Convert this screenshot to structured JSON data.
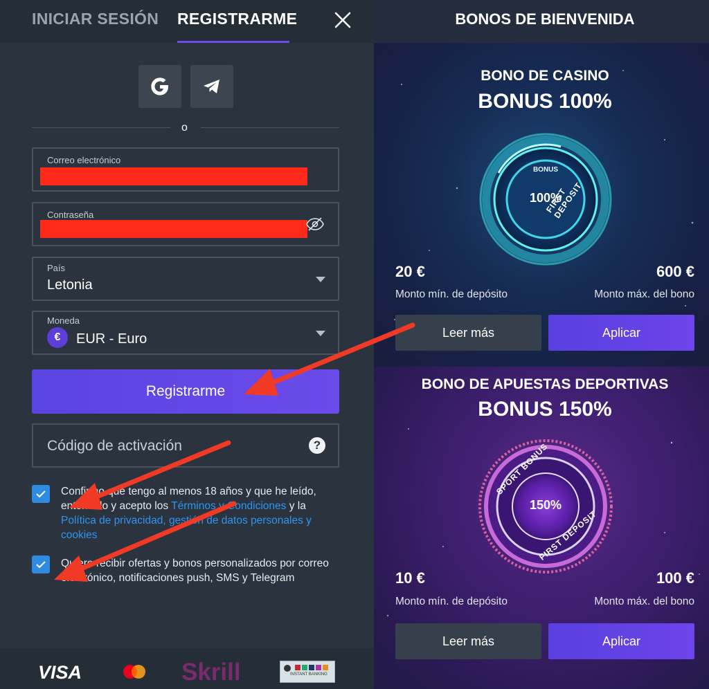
{
  "tabs": {
    "login": "INICIAR SESIÓN",
    "register": "REGISTRARME"
  },
  "social": {
    "google_icon": "google-icon",
    "telegram_icon": "telegram-icon"
  },
  "divider_text": "o",
  "form": {
    "email": {
      "label": "Correo electrónico",
      "value": ""
    },
    "password": {
      "label": "Contraseña",
      "value": ""
    },
    "country": {
      "label": "País",
      "value": "Letonia"
    },
    "currency": {
      "label": "Moneda",
      "symbol": "€",
      "value": "EUR - Euro"
    },
    "submit_label": "Registrarme",
    "activation_code": {
      "placeholder": "Código de activación",
      "help": "?"
    }
  },
  "consents": {
    "terms": {
      "text_before": "Confirmo que tengo al menos 18 años y que he leído, entendido y acepto los ",
      "link_terms": "Términos y Condiciones",
      "text_mid": " y la ",
      "link_privacy": "Política de privacidad, gestión de datos personales y cookies",
      "checked": true
    },
    "marketing": {
      "text": "Quiero recibir ofertas y bonos personalizados por correo electrónico, notificaciones push, SMS y Telegram",
      "checked": true
    }
  },
  "payments": {
    "visa": "VISA",
    "skrill": "Skrill",
    "rapid": "INSTANT BANKING"
  },
  "bonuses": {
    "title": "BONOS DE BIENVENIDA",
    "casino": {
      "title": "BONO DE CASINO",
      "bonus": "BONUS 100%",
      "badge_top": "BONUS",
      "badge_pct": "100%",
      "badge_ring": "FIRST DEPOSIT",
      "min_amount": "20 €",
      "min_label": "Monto mín. de depósito",
      "max_amount": "600 €",
      "max_label": "Monto máx. del bono",
      "more_label": "Leer más",
      "apply_label": "Aplicar"
    },
    "sports": {
      "title": "BONO DE APUESTAS DEPORTIVAS",
      "bonus": "BONUS 150%",
      "badge_top": "SPORT BONUS",
      "badge_pct": "150%",
      "badge_ring": "FIRST DEPOSIT",
      "min_amount": "10 €",
      "min_label": "Monto mín. de depósito",
      "max_amount": "100 €",
      "max_label": "Monto máx. del bono",
      "more_label": "Leer más",
      "apply_label": "Aplicar"
    }
  },
  "colors": {
    "accent": "#6a4be8",
    "link": "#2f95ef",
    "redaction": "#ff2a1a",
    "annotation": "#f03a26"
  }
}
